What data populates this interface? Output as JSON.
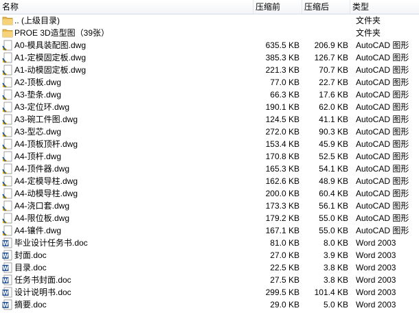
{
  "columns": {
    "name": "名称",
    "compressed": "压缩前",
    "original": "压缩后",
    "type": "类型"
  },
  "rows": [
    {
      "name": ".. (上级目录)",
      "compressed": "",
      "original": "",
      "type": "文件夹",
      "icon": "folder-icon"
    },
    {
      "name": "PROE 3D造型图（39张）",
      "compressed": "",
      "original": "",
      "type": "文件夹",
      "icon": "folder-icon"
    },
    {
      "name": "A0-模具装配图.dwg",
      "compressed": "635.5 KB",
      "original": "206.9 KB",
      "type": "AutoCAD 图形",
      "icon": "dwg-file-icon"
    },
    {
      "name": "A1-定模固定板.dwg",
      "compressed": "385.3 KB",
      "original": "126.7 KB",
      "type": "AutoCAD 图形",
      "icon": "dwg-file-icon"
    },
    {
      "name": "A1-动模固定板.dwg",
      "compressed": "221.3 KB",
      "original": "70.7 KB",
      "type": "AutoCAD 图形",
      "icon": "dwg-file-icon"
    },
    {
      "name": "A2-顶板.dwg",
      "compressed": "77.0 KB",
      "original": "22.7 KB",
      "type": "AutoCAD 图形",
      "icon": "dwg-file-icon"
    },
    {
      "name": "A3-垫条.dwg",
      "compressed": "66.3 KB",
      "original": "17.6 KB",
      "type": "AutoCAD 图形",
      "icon": "dwg-file-icon"
    },
    {
      "name": "A3-定位环.dwg",
      "compressed": "190.1 KB",
      "original": "62.0 KB",
      "type": "AutoCAD 图形",
      "icon": "dwg-file-icon"
    },
    {
      "name": "A3-碗工件图.dwg",
      "compressed": "124.5 KB",
      "original": "41.1 KB",
      "type": "AutoCAD 图形",
      "icon": "dwg-file-icon"
    },
    {
      "name": "A3-型芯.dwg",
      "compressed": "272.0 KB",
      "original": "90.3 KB",
      "type": "AutoCAD 图形",
      "icon": "dwg-file-icon"
    },
    {
      "name": "A4-顶板顶杆.dwg",
      "compressed": "153.4 KB",
      "original": "45.9 KB",
      "type": "AutoCAD 图形",
      "icon": "dwg-file-icon"
    },
    {
      "name": "A4-顶杆.dwg",
      "compressed": "170.8 KB",
      "original": "52.5 KB",
      "type": "AutoCAD 图形",
      "icon": "dwg-file-icon"
    },
    {
      "name": "A4-顶件器.dwg",
      "compressed": "165.3 KB",
      "original": "54.1 KB",
      "type": "AutoCAD 图形",
      "icon": "dwg-file-icon"
    },
    {
      "name": "A4-定模导柱.dwg",
      "compressed": "162.6 KB",
      "original": "48.9 KB",
      "type": "AutoCAD 图形",
      "icon": "dwg-file-icon"
    },
    {
      "name": "A4-动模导柱.dwg",
      "compressed": "200.0 KB",
      "original": "60.4 KB",
      "type": "AutoCAD 图形",
      "icon": "dwg-file-icon"
    },
    {
      "name": "A4-浇口套.dwg",
      "compressed": "173.3 KB",
      "original": "56.1 KB",
      "type": "AutoCAD 图形",
      "icon": "dwg-file-icon"
    },
    {
      "name": "A4-限位板.dwg",
      "compressed": "179.2 KB",
      "original": "55.0 KB",
      "type": "AutoCAD 图形",
      "icon": "dwg-file-icon"
    },
    {
      "name": "A4-镶件.dwg",
      "compressed": "167.1 KB",
      "original": "55.0 KB",
      "type": "AutoCAD 图形",
      "icon": "dwg-file-icon"
    },
    {
      "name": "毕业设计任务书.doc",
      "compressed": "81.0 KB",
      "original": "8.0 KB",
      "type": "Word 2003",
      "icon": "word-doc-icon"
    },
    {
      "name": "封面.doc",
      "compressed": "27.0 KB",
      "original": "3.9 KB",
      "type": "Word 2003",
      "icon": "word-doc-icon"
    },
    {
      "name": "目录.doc",
      "compressed": "22.5 KB",
      "original": "3.8 KB",
      "type": "Word 2003",
      "icon": "word-doc-icon"
    },
    {
      "name": "任务书封面.doc",
      "compressed": "27.5 KB",
      "original": "3.8 KB",
      "type": "Word 2003",
      "icon": "word-doc-icon"
    },
    {
      "name": "设计说明书.doc",
      "compressed": "299.5 KB",
      "original": "101.4 KB",
      "type": "Word 2003",
      "icon": "word-doc-icon"
    },
    {
      "name": "摘要.doc",
      "compressed": "29.0 KB",
      "original": "5.0 KB",
      "type": "Word 2003",
      "icon": "word-doc-icon"
    }
  ]
}
